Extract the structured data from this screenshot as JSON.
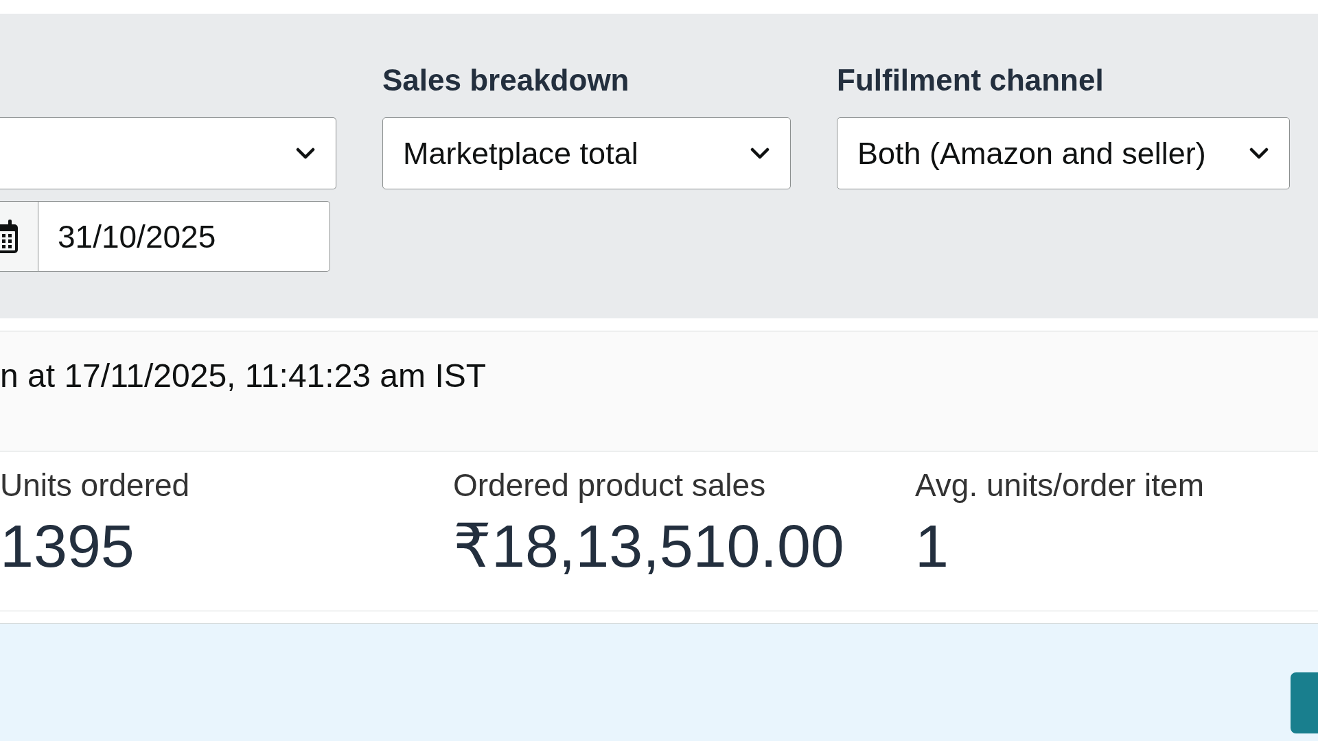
{
  "filters": [
    {
      "kind": "date",
      "date": "31/10/2025"
    },
    {
      "kind": "select",
      "label": "Sales breakdown",
      "value": "Marketplace total"
    },
    {
      "kind": "select",
      "label": "Fulfilment channel",
      "value": "Both (Amazon and seller)"
    }
  ],
  "last_updated": "n at 17/11/2025, 11:41:23 am IST",
  "metrics": [
    {
      "label": "Units ordered",
      "value": "1395"
    },
    {
      "label": "Ordered product sales",
      "value": "₹18,13,510.00"
    },
    {
      "label": "Avg. units/order item",
      "value": "1"
    }
  ]
}
